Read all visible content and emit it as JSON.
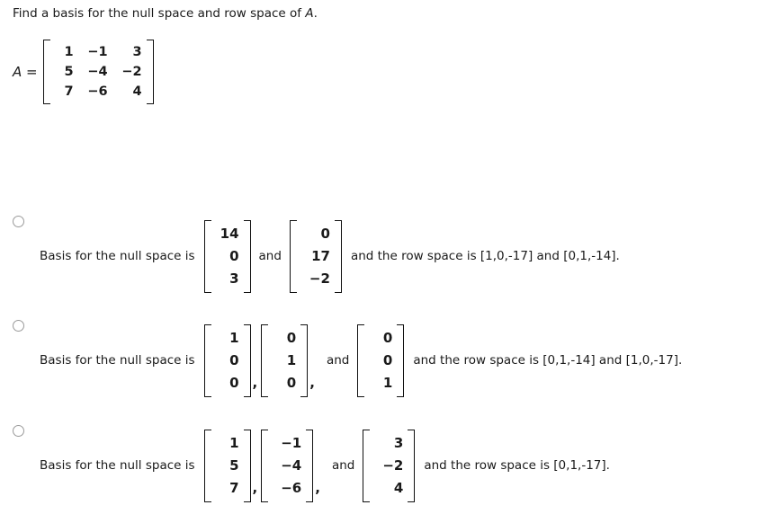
{
  "question": {
    "text_before": "Find a basis for the null space and row space of ",
    "matrix_symbol": "A",
    "text_after": "."
  },
  "matrix_a": {
    "label": "A =",
    "rows": [
      [
        "1",
        "−1",
        "3"
      ],
      [
        "5",
        "−4",
        "−2"
      ],
      [
        "7",
        "−6",
        "4"
      ]
    ]
  },
  "options": [
    {
      "label": "Basis for the null space is",
      "vectors": [
        [
          "14",
          "0",
          "3"
        ],
        [
          "0",
          "17",
          "−2"
        ]
      ],
      "separators": [
        "and"
      ],
      "tail": "and the row space is [1,0,-17] and [0,1,-14]."
    },
    {
      "label": "Basis for the null space is",
      "vectors": [
        [
          "1",
          "0",
          "0"
        ],
        [
          "0",
          "1",
          "0"
        ],
        [
          "0",
          "0",
          "1"
        ]
      ],
      "separators": [
        ",",
        ",",
        "and"
      ],
      "tail": "and the row space is [0,1,-14] and [1,0,-17]."
    },
    {
      "label": "Basis for the null space is",
      "vectors": [
        [
          "1",
          "5",
          "7"
        ],
        [
          "−1",
          "−4",
          "−6"
        ],
        [
          "3",
          "−2",
          "4"
        ]
      ],
      "separators": [
        ",",
        ",",
        "and"
      ],
      "tail": "and the row space is [0,1,-17]."
    }
  ]
}
